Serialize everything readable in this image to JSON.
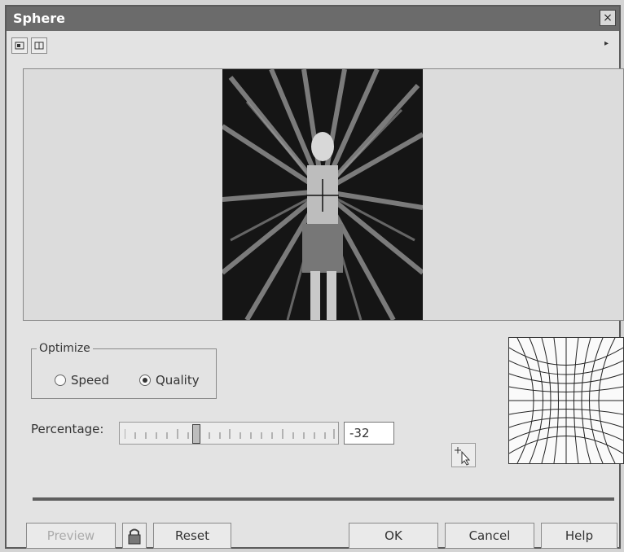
{
  "window": {
    "title": "Sphere",
    "close_icon": "×"
  },
  "toolbar": {
    "items": [
      "single-preview-icon",
      "split-preview-icon"
    ],
    "menu_arrow": "▸"
  },
  "optimize": {
    "legend": "Optimize",
    "options": [
      {
        "label": "Speed",
        "selected": false
      },
      {
        "label": "Quality",
        "selected": true
      }
    ]
  },
  "percentage": {
    "label": "Percentage:",
    "value": "-32",
    "min": -100,
    "max": 100
  },
  "buttons": {
    "preview": "Preview",
    "reset": "Reset",
    "ok": "OK",
    "cancel": "Cancel",
    "help": "Help"
  },
  "colors": {
    "title_bar": "#6b6b6b",
    "dialog_bg": "#e3e3e3"
  }
}
